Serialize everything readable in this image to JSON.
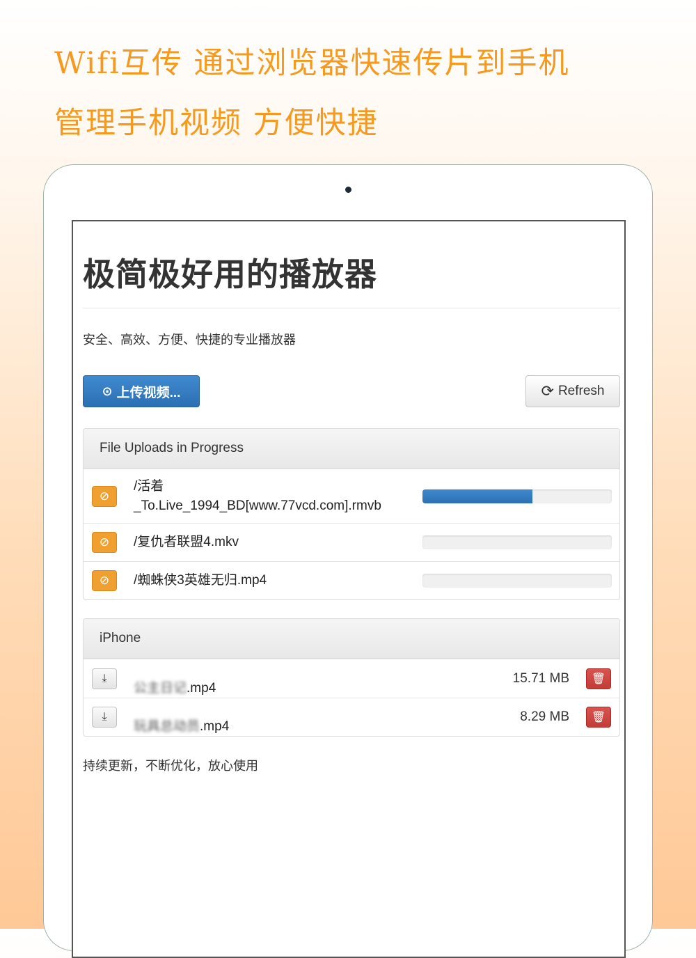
{
  "headline": "Wifi互传 通过浏览器快速传片到手机 管理手机视频 方便快捷",
  "app": {
    "title": "极简极好用的播放器",
    "subtitle": "安全、高效、方便、快捷的专业播放器",
    "footer": "持续更新，不断优化，放心使用"
  },
  "toolbar": {
    "upload_icon": "upload-circle-icon",
    "upload_glyph": "⊙",
    "upload_label": "上传视频...",
    "refresh_icon": "refresh-icon",
    "refresh_glyph": "⟳",
    "refresh_label": "Refresh"
  },
  "uploads": {
    "heading": "File Uploads in Progress",
    "cancel_glyph": "⊘",
    "items": [
      {
        "name": "/活着\n_To.Live_1994_BD[www.77vcd.com].rmvb",
        "progress": 0.58
      },
      {
        "name": "/复仇者联盟4.mkv",
        "progress": 0
      },
      {
        "name": "/蜘蛛侠3英雄无归.mp4",
        "progress": 0
      }
    ]
  },
  "device": {
    "heading": "iPhone",
    "download_glyph": "⤓",
    "delete_glyph": "🗑",
    "files": [
      {
        "name_obscured": "公主日记",
        "name_tail": ".mp4",
        "size": "15.71 MB"
      },
      {
        "name_obscured": "玩具总动员",
        "name_tail": ".mp4",
        "size": "8.29 MB"
      }
    ]
  },
  "colors": {
    "headline": "#f59a1e",
    "primary": "#2c6fb3",
    "warning": "#f0a030",
    "danger": "#d9534f"
  }
}
